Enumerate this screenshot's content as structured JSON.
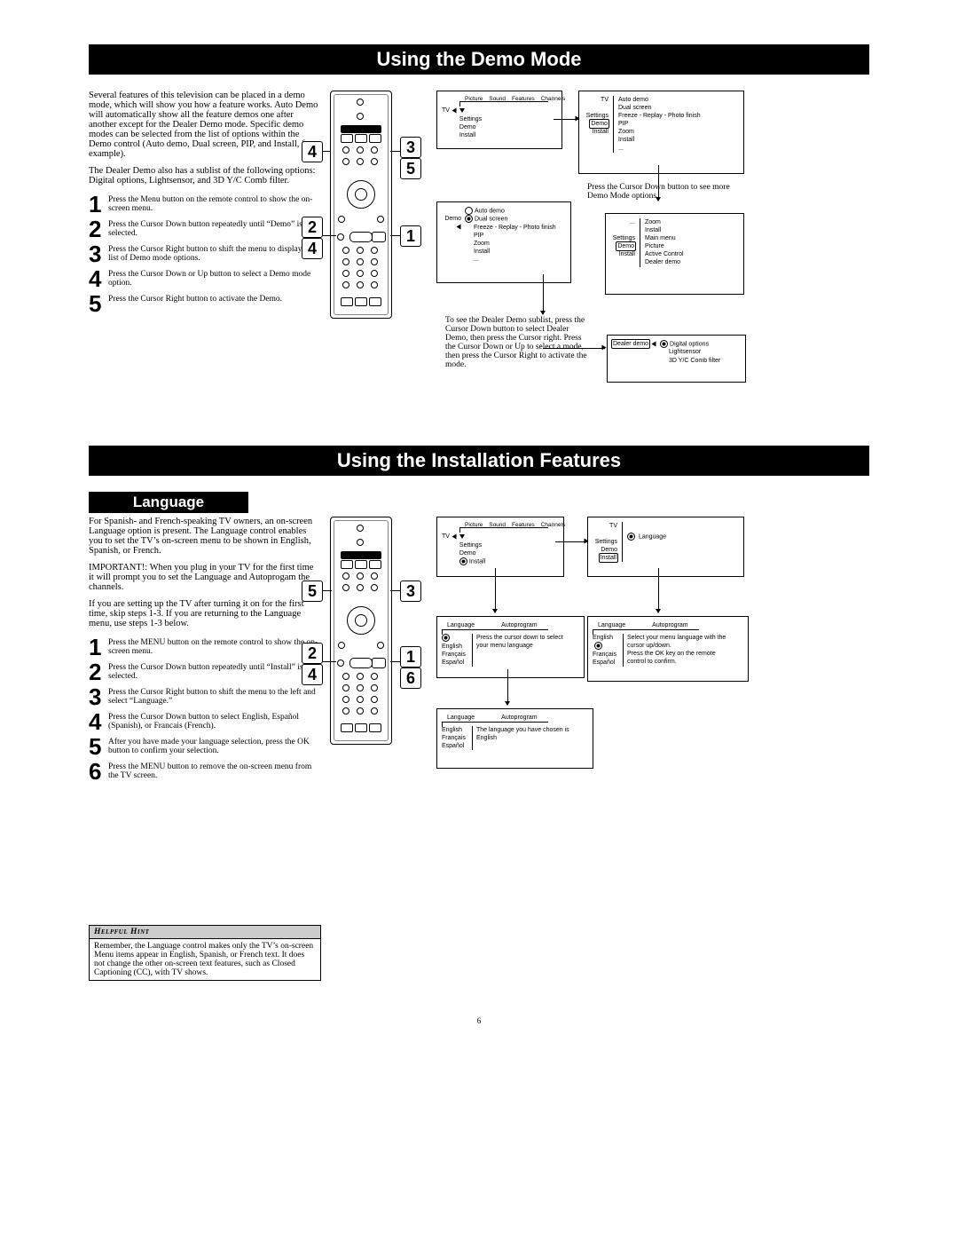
{
  "page_number": "6",
  "section1": {
    "title": "Using the Demo Mode",
    "intro1": "Several features of this television can be placed in a demo mode, which will show you how a feature works. Auto Demo will automatically show all the feature demos one after another except for the Dealer Demo mode. Specific demo modes can be selected from the list of options within the Demo control (Auto demo, Dual screen, PIP, and Install, for example).",
    "intro2": "The Dealer Demo also has a sublist of the following options: Digital options, Lightsensor, and 3D Y/C Comb filter.",
    "steps": [
      "Press the Menu button on the remote control to show the on-screen menu.",
      "Press the Cursor Down button repeatedly until “Demo” is selected.",
      "Press the Cursor Right button to shift the menu to display the list of Demo mode options.",
      "Press the Cursor Down or Up button to select a Demo mode option.",
      "Press the Cursor Right button to activate the Demo."
    ],
    "caption1": "Press the Cursor Down button to see more Demo Mode options.",
    "caption2": "To see the Dealer Demo sublist, press the Cursor Down button to select Dealer Demo, then press the Cursor right. Press the Cursor Down or Up to select a mode, then press the Cursor Right to activate the mode.",
    "osd1_top_menu": [
      "Picture",
      "Sound",
      "Features",
      "Channels"
    ],
    "osd1_left_items": [
      "Settings",
      "Demo",
      "Install"
    ],
    "osd1_tv": "TV",
    "osd2_demo_items": [
      "Auto demo",
      "Dual screen",
      "Freeze - Replay - Photo finish",
      "PIP",
      "Zoom",
      "Install",
      "..."
    ],
    "osd3_items": [
      "Zoom",
      "Install",
      "Main menu",
      "Picture",
      "Active Control",
      "Dealer demo"
    ],
    "osd3_side": [
      "Settings",
      "Demo",
      "Install"
    ],
    "osd3_dots": "...",
    "osd4_demo_label": "Demo",
    "osd4_items": [
      "Auto demo",
      "Dual screen",
      "Freeze - Replay - Photo finish",
      "PIP",
      "Zoom",
      "Install",
      "..."
    ],
    "osd5_left": "Dealer demo",
    "osd5_right": [
      "Digital options",
      "Lightsensor",
      "3D Y/C Comb filter"
    ]
  },
  "section2": {
    "title": "Using the Installation Features",
    "subtitle": "Language",
    "intro1": "For Spanish- and French-speaking TV owners, an on-screen Language option is present. The Language control enables you to set the TV’s on-screen menu to be shown in English, Spanish, or French.",
    "intro2": "IMPORTANT!:  When you plug in your TV for the first time it will prompt you to set the Language and Autoprogam the channels.",
    "intro3": "If you are setting up the TV after turning it on for the first time, skip steps 1-3.  If you are returning to the Language menu, use steps 1-3 below.",
    "steps": [
      "Press the MENU button on the remote control to show the on-screen menu.",
      "Press the Cursor Down button repeatedly until “Install” is selected.",
      "Press the Cursor Right button to shift the menu to the left and select “Language.”",
      "Press the Cursor Down button to select English, Español (Spanish), or Francais (French).",
      "After you have made your language selection, press the OK button to confirm your selection.",
      "Press the MENU button to remove the on-screen menu from the TV screen."
    ],
    "osd1_top": [
      "Picture",
      "Sound",
      "Features",
      "Channels"
    ],
    "osd1_tv": "TV",
    "osd1_items": [
      "Settings",
      "Demo",
      "Install"
    ],
    "osd2_items": [
      "Settings",
      "Demo",
      "Install"
    ],
    "osd2_right": "Language",
    "osd3_headers": [
      "Language",
      "Autoprogram"
    ],
    "osd3_left": [
      "English",
      "Français",
      "Español"
    ],
    "osd3_text": "Press the cursor down to select your menu language",
    "osd4_headers": [
      "Language",
      "Autoprogram"
    ],
    "osd4_left": [
      "English",
      "Français",
      "Español"
    ],
    "osd4_text1": "Select your menu language with the cursor up/down.",
    "osd4_text2": "Press the OK key on the remote control to confirm.",
    "osd5_headers": [
      "Language",
      "Autoprogram"
    ],
    "osd5_left": [
      "English",
      "Français",
      "Español"
    ],
    "osd5_text": "The language you have chosen is English"
  },
  "hint": {
    "title": "Helpful Hint",
    "body": "Remember, the Language control makes only the TV’s on-screen Menu items appear in English, Spanish, or French text. It does not change the other on-screen text features, such as Closed Captioning (CC), with TV shows."
  }
}
